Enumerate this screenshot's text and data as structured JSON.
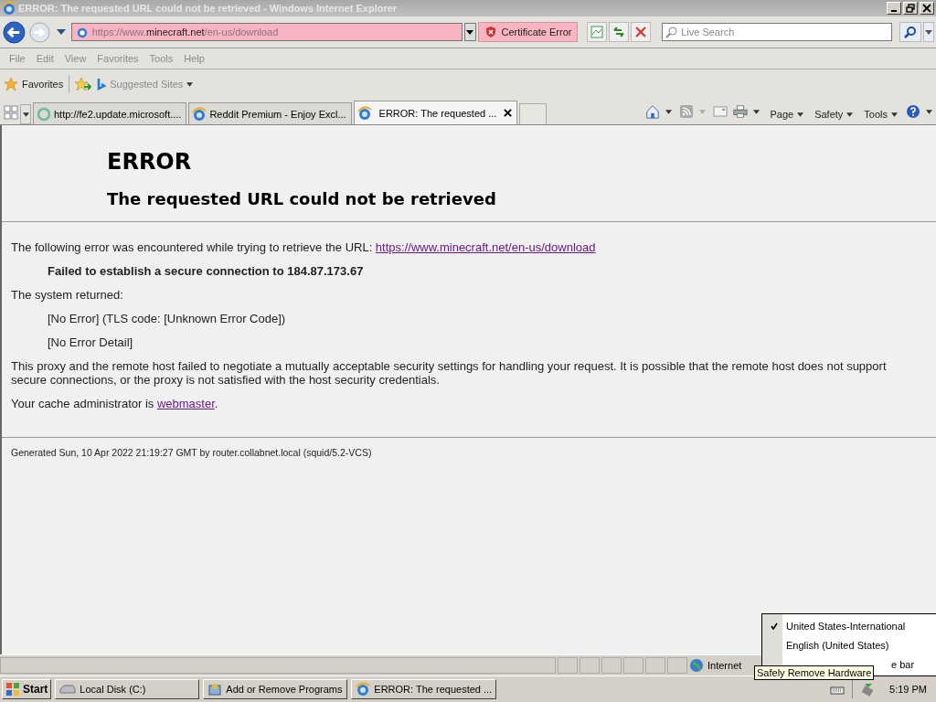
{
  "window": {
    "title": "ERROR: The requested URL could not be retrieved - Windows Internet Explorer"
  },
  "address_bar": {
    "url_parts": [
      "https://www.",
      "minecraft.net",
      "/en-us/download"
    ],
    "certificate": "Certificate Error",
    "search_placeholder": "Live Search"
  },
  "menu": [
    "File",
    "Edit",
    "View",
    "Favorites",
    "Tools",
    "Help"
  ],
  "favorites_bar": {
    "favorites": "Favorites",
    "suggested": "Suggested Sites"
  },
  "tabs": [
    {
      "label": "http://fe2.update.microsoft....",
      "selected": false,
      "kind": "loading"
    },
    {
      "label": "Reddit Premium - Enjoy Excl...",
      "selected": false,
      "kind": "ie"
    },
    {
      "label": "ERROR: The requested ...",
      "selected": true,
      "kind": "ie"
    }
  ],
  "command_bar": [
    "Page",
    "Safety",
    "Tools"
  ],
  "page": {
    "heading": "ERROR",
    "subheading": "The requested URL could not be retrieved",
    "intro": "The following error was encountered while trying to retrieve the URL: ",
    "intro_link": "https://www.minecraft.net/en-us/download",
    "error": "Failed to establish a secure connection to 184.87.173.67",
    "system_returned": "The system returned:",
    "details": [
      "[No Error] (TLS code: [Unknown Error Code])",
      "[No Error Detail]"
    ],
    "explanation": "This proxy and the remote host failed to negotiate a mutually acceptable security settings for handling your request. It is possible that the remote host does not support secure connections, or the proxy is not satisfied with the host security credentials.",
    "admin": "Your cache administrator is ",
    "admin_link": "webmaster",
    "admin_end": ".",
    "footer": "Generated Sun, 10 Apr 2022 21:19:27 GMT by router.collabnet.local (squid/5.2-VCS)"
  },
  "status_bar": {
    "zone": "Internet"
  },
  "taskbar": {
    "start": "Start",
    "tasks": [
      {
        "label": "Local Disk (C:)",
        "selected": false,
        "kind": "disk"
      },
      {
        "label": "Add or Remove Programs",
        "selected": false,
        "kind": "programs"
      },
      {
        "label": "ERROR: The requested ...",
        "selected": false,
        "kind": "ie"
      }
    ],
    "clock": "5:19 PM"
  },
  "context_menu": [
    {
      "label": "United States-International",
      "checked": true
    },
    {
      "label": "English (United States)",
      "checked": false
    },
    {
      "label": "e bar",
      "checked": false
    }
  ],
  "tooltip": "Safely Remove Hardware"
}
